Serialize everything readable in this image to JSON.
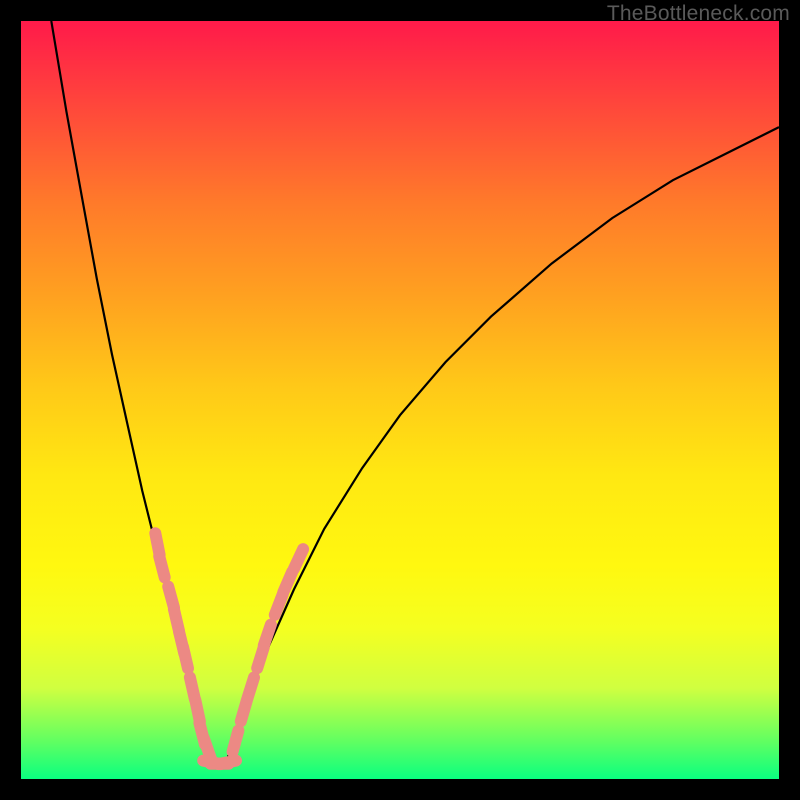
{
  "watermark": "TheBottleneck.com",
  "chart_data": {
    "type": "line",
    "title": "",
    "xlabel": "",
    "ylabel": "",
    "xlim": [
      0,
      100
    ],
    "ylim": [
      0,
      100
    ],
    "series": [
      {
        "name": "left-branch",
        "x": [
          4,
          6,
          8,
          10,
          12,
          14,
          16,
          18,
          20,
          22,
          23.5,
          25
        ],
        "values": [
          100,
          88,
          77,
          66,
          56,
          47,
          38,
          30,
          22,
          14,
          8,
          2
        ]
      },
      {
        "name": "right-branch",
        "x": [
          27,
          29,
          32,
          36,
          40,
          45,
          50,
          56,
          62,
          70,
          78,
          86,
          94,
          100
        ],
        "values": [
          2,
          8,
          16,
          25,
          33,
          41,
          48,
          55,
          61,
          68,
          74,
          79,
          83,
          86
        ]
      }
    ],
    "highlight_segments": {
      "note": "salmon line-segment markers overlaid on the curve near the minimum",
      "left": [
        {
          "x": 18.0,
          "y": 31
        },
        {
          "x": 18.6,
          "y": 28
        },
        {
          "x": 19.8,
          "y": 24
        },
        {
          "x": 20.5,
          "y": 21
        },
        {
          "x": 21.2,
          "y": 18
        },
        {
          "x": 21.7,
          "y": 16
        },
        {
          "x": 22.6,
          "y": 12
        },
        {
          "x": 23.3,
          "y": 9
        },
        {
          "x": 23.9,
          "y": 6
        },
        {
          "x": 24.6,
          "y": 4
        }
      ],
      "bottom": [
        {
          "x": 25.2,
          "y": 2.2
        },
        {
          "x": 26.2,
          "y": 2.0
        },
        {
          "x": 27.2,
          "y": 2.2
        }
      ],
      "right": [
        {
          "x": 28.3,
          "y": 5
        },
        {
          "x": 29.4,
          "y": 9
        },
        {
          "x": 30.3,
          "y": 12
        },
        {
          "x": 31.6,
          "y": 16
        },
        {
          "x": 32.5,
          "y": 19
        },
        {
          "x": 34.0,
          "y": 23
        },
        {
          "x": 35.2,
          "y": 26
        },
        {
          "x": 36.6,
          "y": 29
        }
      ]
    },
    "colors": {
      "curve": "#000000",
      "segment": "#ec8984",
      "gradient_top": "#ff1a4a",
      "gradient_bottom": "#0aff80"
    }
  }
}
